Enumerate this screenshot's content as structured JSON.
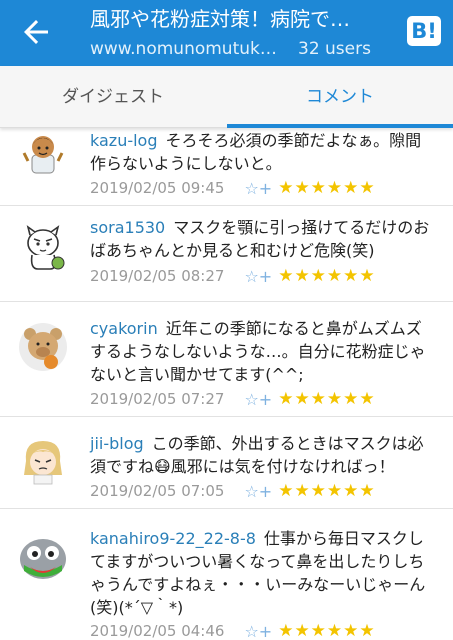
{
  "header": {
    "title": "風邪や花粉症対策！病院で…",
    "url": "www.nomunomutuk…",
    "users": "32 users",
    "hatena_logo": "B!"
  },
  "tabs": [
    {
      "label": "ダイジェスト"
    },
    {
      "label": "コメント"
    }
  ],
  "comments": [
    {
      "user": "kazu-log",
      "text": "そろそろ必須の季節だよなぁ。隙間作らないようにしないと。",
      "date": "2019/02/05 09:45",
      "star_add": "☆+",
      "stars": "★★★★★★"
    },
    {
      "user": "sora1530",
      "text": "マスクを顎に引っ掻けてるだけのおばあちゃんとか見ると和むけど危険(笑)",
      "date": "2019/02/05 08:27",
      "star_add": "☆+",
      "stars": "★★★★★★"
    },
    {
      "user": "cyakorin",
      "text": "近年この季節になると鼻がムズムズするようなしないような…。自分に花粉症じゃないと言い聞かせてます(^^;",
      "date": "2019/02/05 07:27",
      "star_add": "☆+",
      "stars": "★★★★★★"
    },
    {
      "user": "jii-blog",
      "text": "この季節、外出するときはマスクは必須ですね😷風邪には気を付けなければっ！",
      "date": "2019/02/05 07:05",
      "star_add": "☆+",
      "stars": "★★★★★★"
    },
    {
      "user": "kanahiro9-22_22-8-8",
      "text": "仕事から毎日マスクしてますがついつい暑くなって鼻を出したりしちゃうんですよねぇ・・・いーみなーいじゃーん(笑)(*´▽｀*)",
      "date": "2019/02/05 04:46",
      "star_add": "☆+",
      "stars": "★★★★★★"
    }
  ]
}
